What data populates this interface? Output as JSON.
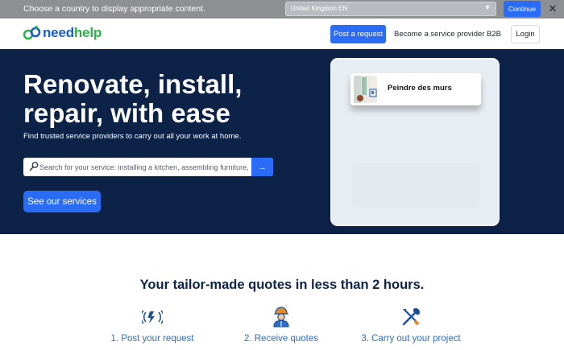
{
  "country_banner": {
    "message": "Choose a country to display appropriate content.",
    "selected_country": "United Kingdom EN",
    "continue_label": "Continue",
    "close_label": "✕"
  },
  "header": {
    "logo_need": "need",
    "logo_help": "help",
    "post_request_label": "Post a request",
    "become_provider_label": "Become a service provider",
    "b2b_label": "B2B",
    "login_label": "Login"
  },
  "hero": {
    "title": "Renovate, install, repair, with ease",
    "subtitle": "Find trusted service providers to carry out all your work at home.",
    "search_placeholder": "Search for your service: installing a kitchen, assembling furniture, e",
    "search_button_glyph": "→",
    "services_button_label": "See our services",
    "preview_item_label": "Peindre des murs"
  },
  "steps": {
    "tagline": "Your tailor-made quotes in less than 2 hours.",
    "items": [
      {
        "label": "1. Post your request",
        "icon": "lightning-request-icon"
      },
      {
        "label": "2. Receive quotes",
        "icon": "worker-icon"
      },
      {
        "label": "3. Carry out your project",
        "icon": "tools-icon"
      }
    ]
  },
  "colors": {
    "accent": "#2b6cf6",
    "hero_bg": "#0c2347",
    "banner_bg": "#8e8f93",
    "brand_blue": "#1b5fc7",
    "brand_green": "#28b446",
    "step_text": "#2f6cc4"
  }
}
